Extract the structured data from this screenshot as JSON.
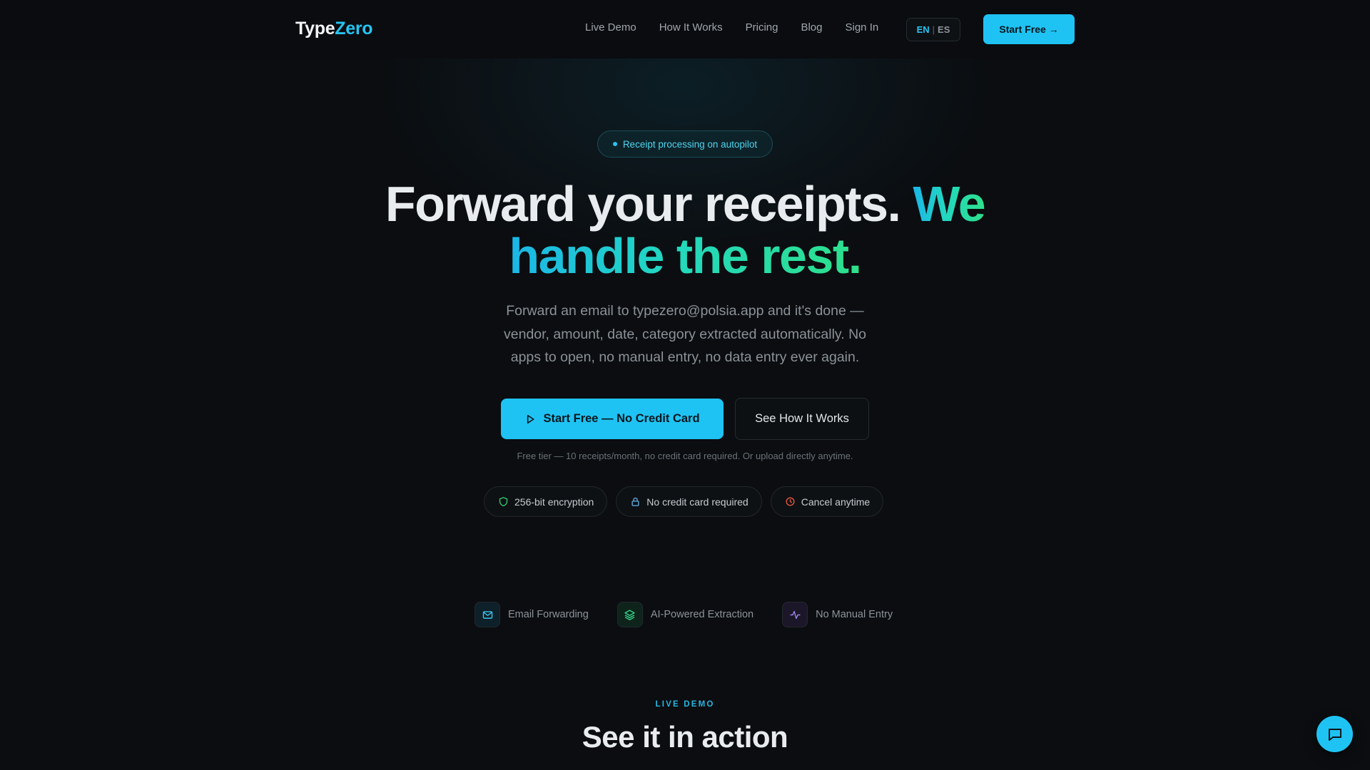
{
  "brand": {
    "name_part1": "Type",
    "name_part2": "Zero"
  },
  "nav": {
    "links": [
      "Live Demo",
      "How It Works",
      "Pricing",
      "Blog",
      "Sign In"
    ],
    "lang_active": "EN",
    "lang_separator": "|",
    "lang_other": "ES",
    "cta_label": "Start Free →"
  },
  "hero": {
    "pill_label": "Receipt processing on autopilot",
    "headline_plain": "Forward your receipts.",
    "headline_accent_line1": "We",
    "headline_accent_line2": "handle the rest.",
    "subtext": "Forward an email to typezero@polsia.app and it's done — vendor, amount, date, category extracted automatically. No apps to open, no manual entry, no data entry ever again.",
    "primary_cta": "Start Free — No Credit Card",
    "secondary_cta": "See How It Works",
    "fine_print": "Free tier — 10 receipts/month, no credit card required. Or upload directly anytime.",
    "badges": [
      {
        "label": "256-bit encryption",
        "icon": "shield-icon"
      },
      {
        "label": "No credit card required",
        "icon": "lock-icon"
      },
      {
        "label": "Cancel anytime",
        "icon": "clock-icon"
      }
    ]
  },
  "features": [
    {
      "label": "Email Forwarding",
      "icon": "mail-icon"
    },
    {
      "label": "AI-Powered Extraction",
      "icon": "layers-icon"
    },
    {
      "label": "No Manual Entry",
      "icon": "activity-icon"
    }
  ],
  "demo_section": {
    "eyebrow": "LIVE DEMO",
    "title": "See it in action"
  },
  "chat": {
    "icon": "chat-icon"
  },
  "colors": {
    "background": "#0b0d10",
    "accent": "#1fc3f3",
    "gradient_start": "#1bb6e8",
    "gradient_end": "#2ee08a",
    "shield_green": "#2ecc71",
    "lock_blue": "#5aa8d8",
    "clock_red": "#e5553f"
  }
}
